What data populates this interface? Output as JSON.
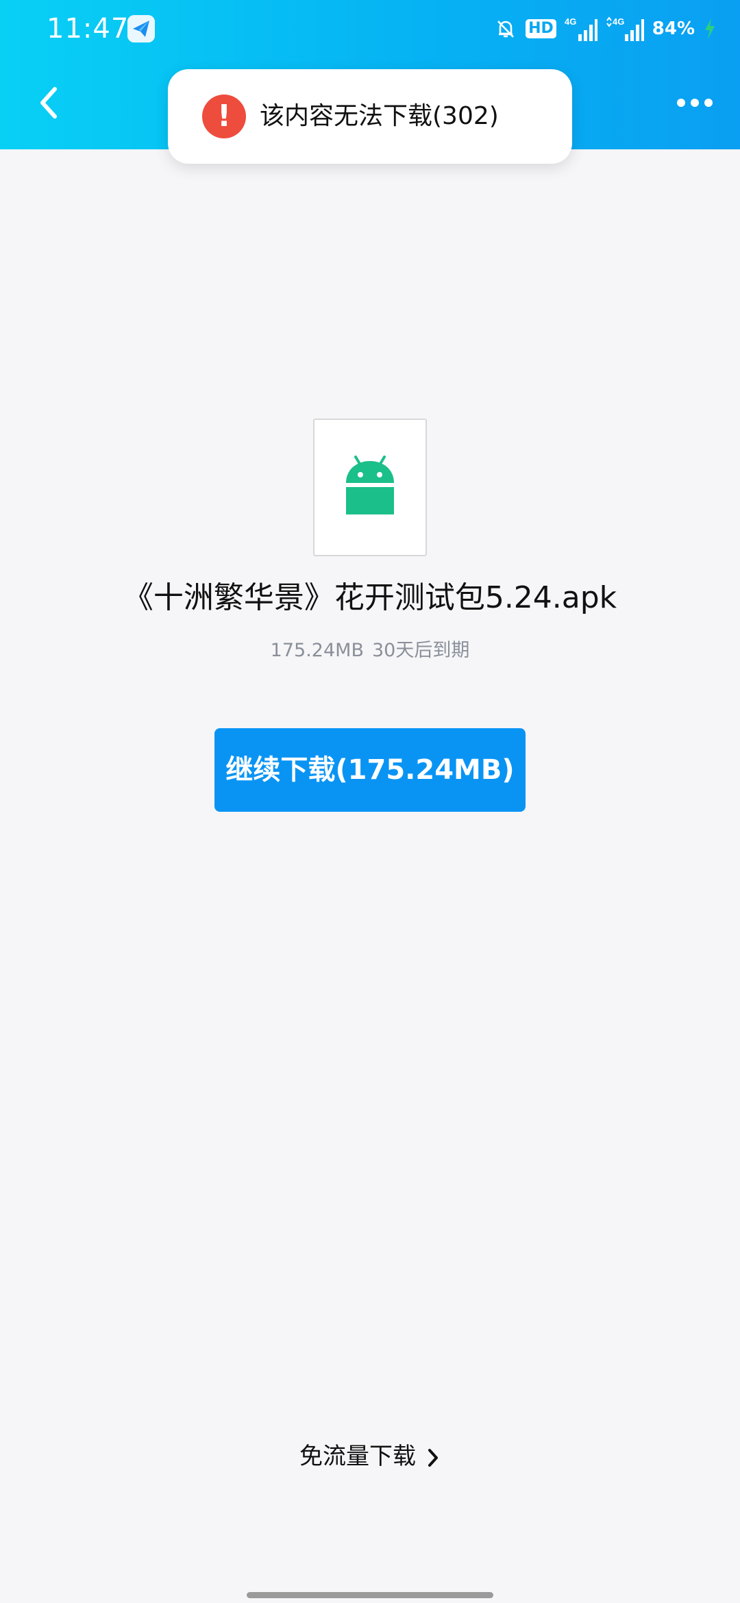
{
  "status_bar": {
    "time": "11:47",
    "hd_badge": "HD",
    "network_1": "4G",
    "network_2": "4G",
    "battery": "84%"
  },
  "toast": {
    "icon": "!",
    "message": "该内容无法下载(302)"
  },
  "file": {
    "icon": "android-icon",
    "name": "《十洲繁华景》花开测试包5.24.apk",
    "size": "175.24MB",
    "expiry": "30天后到期"
  },
  "actions": {
    "download_label": "继续下载(175.24MB)",
    "free_data_label": "免流量下载"
  },
  "colors": {
    "header_gradient_start": "#08d0f5",
    "header_gradient_end": "#0a9ff2",
    "primary_button": "#0994f4",
    "error": "#ee4c3d",
    "android_green": "#1bbf89",
    "background": "#f6f6f8"
  }
}
